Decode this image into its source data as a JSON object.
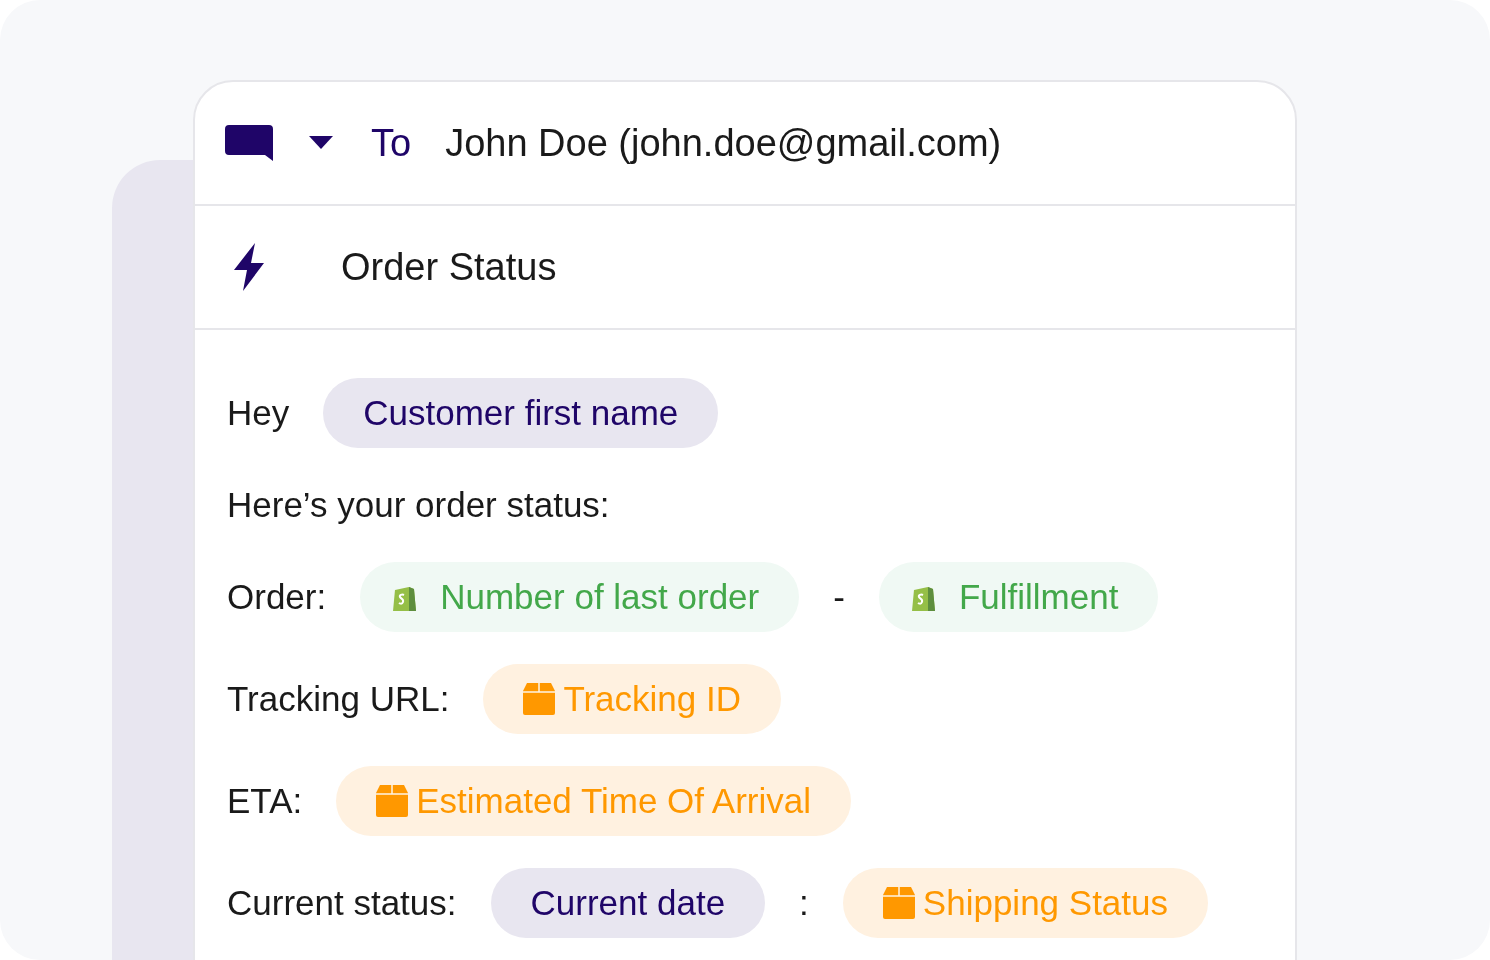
{
  "header": {
    "to_label": "To",
    "recipient": "John Doe (john.doe@gmail.com)"
  },
  "template": {
    "title": "Order Status"
  },
  "lines": [
    {
      "parts": [
        {
          "kind": "text",
          "text": "Hey"
        },
        {
          "kind": "variable",
          "text": "Customer first name"
        }
      ]
    },
    {
      "parts": [
        {
          "kind": "text",
          "text": "Here’s your order status:"
        }
      ]
    },
    {
      "parts": [
        {
          "kind": "text",
          "text": "Order:"
        },
        {
          "kind": "shopify",
          "text": "Number of last order"
        },
        {
          "kind": "text",
          "text": "-"
        },
        {
          "kind": "shopify",
          "text": "Fulfillment"
        }
      ]
    },
    {
      "parts": [
        {
          "kind": "text",
          "text": "Tracking URL:"
        },
        {
          "kind": "shipping",
          "text": "Tracking ID"
        }
      ]
    },
    {
      "parts": [
        {
          "kind": "text",
          "text": "ETA:"
        },
        {
          "kind": "shipping",
          "text": "Estimated Time Of Arrival"
        }
      ]
    },
    {
      "parts": [
        {
          "kind": "text",
          "text": "Current status:"
        },
        {
          "kind": "variable",
          "text": "Current date"
        },
        {
          "kind": "text",
          "text": ":"
        },
        {
          "kind": "shipping",
          "text": "Shipping Status"
        }
      ]
    }
  ]
}
